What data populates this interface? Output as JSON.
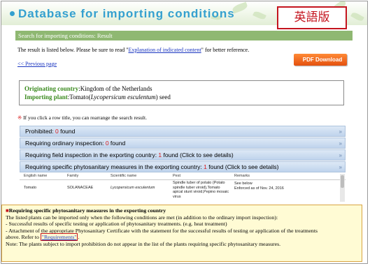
{
  "header": {
    "title": "Database for importing conditions",
    "english_badge": "英語版"
  },
  "result_bar": {
    "label": "Search for importing conditions: Result"
  },
  "intro": {
    "before": "The result is listed below. Please be sure to read \"",
    "link": "Explanation of indicated content",
    "after": "\" for better reference."
  },
  "previous_link": "<< Previous page",
  "pdf_button": "PDF Download",
  "conditions": {
    "origin_label": "Originating country",
    "origin_value": ":Kingdom of the Netherlands",
    "plant_label": "Importing plant",
    "plant_value_prefix": ":Tomato(",
    "plant_scientific": "Lycopersicum esculentum",
    "plant_value_suffix": ") seed"
  },
  "sort_note": {
    "mark": "※",
    "text": " If you click a row title, you can rearrange the search result."
  },
  "categories": [
    {
      "label": "Prohibited: ",
      "count": "0",
      "suffix": " found"
    },
    {
      "label": "Requiring ordinary inspection: ",
      "count": "0",
      "suffix": " found"
    },
    {
      "label": "Requiring field inspection in the exporting country: ",
      "count": "1",
      "suffix": " found (Click to see details)"
    },
    {
      "label": "Requiring specific phytosanitary measures in the exporting country: ",
      "count": "1",
      "suffix": " found (Click to see details)"
    }
  ],
  "table": {
    "headers": [
      "English name",
      "Family",
      "Scientific name",
      "Pest",
      "Remarks"
    ],
    "row": {
      "english_name": "Tomato",
      "family": "SOLANACEAE",
      "scientific_name": "Lycopersicum esculentum",
      "pest": "Spindle tuber of potato (Potato spindle tuber viroid),Tomato apical stunt viroid,Pepino mosaic virus",
      "remarks_line1": "See below",
      "remarks_line2": "Enforced as of Nov. 24, 2016"
    }
  },
  "explanation": {
    "heading_mark": "■",
    "heading": "Requiring specific phytosanitary measures in the exporting country",
    "line1": "The listed plants can be imported only when the following conditions are met (in addition to the ordinary import inspection):",
    "line2": "- Successful results of specific testing or application of phytosanitary treatments. (e.g. heat treatment)",
    "line3": "- Attachment of the appropriate Phytosanitary Certificate with the statement for the successful results of testing or application of the treatments",
    "line4_before": "above. Refer to ",
    "line4_link": "\"Requirements\"",
    "line4_after": ".",
    "line5": "Note: The plants subject to import prohibition do not appear in the list of the plants requiring specific phytosanitary measures."
  }
}
